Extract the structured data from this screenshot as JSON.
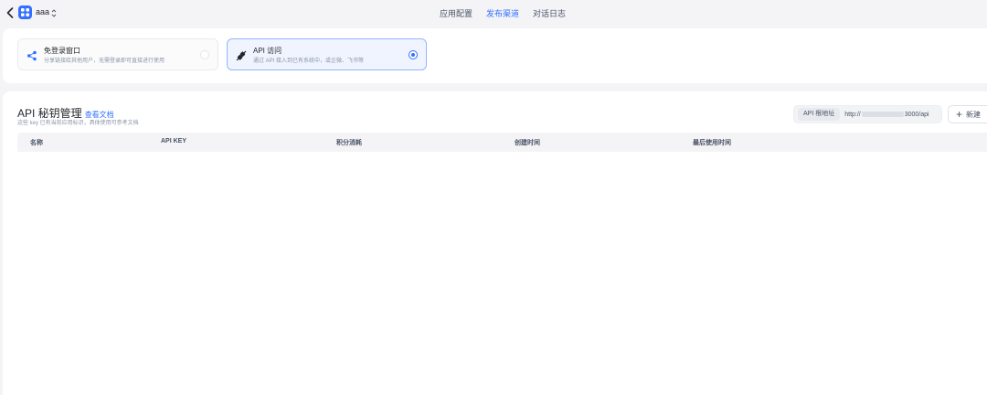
{
  "topbar": {
    "app_name": "aaa",
    "tabs": [
      {
        "label": "应用配置",
        "active": false
      },
      {
        "label": "发布渠道",
        "active": true
      },
      {
        "label": "对话日志",
        "active": false
      }
    ]
  },
  "channels": [
    {
      "title": "免登录窗口",
      "desc": "分享链接给其他用户，无需登录即可直接进行使用",
      "selected": false
    },
    {
      "title": "API 访问",
      "desc": "通过 API 接入到已有系统中，或企微、飞书等",
      "selected": true
    }
  ],
  "main": {
    "title": "API 秘钥管理",
    "doc_link": "查看文档",
    "subtitle": "这些 key 已有当前应用标识，具体使用可参考文档",
    "api_root_label": "API 根地址",
    "api_root_prefix": "http://",
    "api_root_suffix": "3000/api",
    "new_button": "新建",
    "columns": [
      "名称",
      "API KEY",
      "积分消耗",
      "创建时间",
      "最后使用时间"
    ]
  },
  "colors": {
    "accent": "#3370ff",
    "background": "#f4f4f7"
  }
}
